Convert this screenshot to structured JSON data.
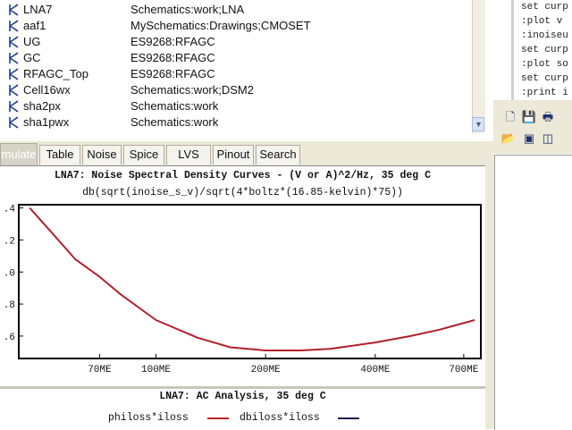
{
  "cell_list": {
    "rows": [
      {
        "name": "LNA7",
        "library": "Schematics:work;LNA"
      },
      {
        "name": "aaf1",
        "library": "MySchematics:Drawings;CMOSET"
      },
      {
        "name": "UG",
        "library": "ES9268:RFAGC"
      },
      {
        "name": "GC",
        "library": "ES9268:RFAGC"
      },
      {
        "name": "RFAGC_Top",
        "library": "ES9268:RFAGC"
      },
      {
        "name": "Cell16wx",
        "library": "Schematics:work;DSM2"
      },
      {
        "name": "sha2px",
        "library": "Schematics:work"
      },
      {
        "name": "sha1pwx",
        "library": "Schematics:work"
      }
    ],
    "icon": "schematic-cell-icon"
  },
  "console": {
    "lines": [
      "set curp",
      ":plot v",
      ":inoiseu",
      "set curp",
      ":plot so",
      "set curp",
      ":print i"
    ]
  },
  "tabs": [
    {
      "label": "mulate",
      "active": true
    },
    {
      "label": "Table",
      "active": false
    },
    {
      "label": "Noise",
      "active": false
    },
    {
      "label": "Spice",
      "active": false
    },
    {
      "label": "LVS",
      "active": false
    },
    {
      "label": "Pinout",
      "active": false
    },
    {
      "label": "Search",
      "active": false
    }
  ],
  "plot": {
    "title": "LNA7: Noise Spectral Density Curves - (V or A)^2/Hz, 35 deg C",
    "subtitle": "db(sqrt(inoise_s_v)/sqrt(4*boltz*(16.85-kelvin)*75))"
  },
  "chart_data": {
    "type": "line",
    "title": "LNA7: Noise Spectral Density Curves - (V or A)^2/Hz, 35 deg C",
    "subtitle": "db(sqrt(inoise_s_v)/sqrt(4*boltz*(16.85-kelvin)*75))",
    "x_scale": "log",
    "x_ticks": [
      {
        "value": 70,
        "label": "70ME"
      },
      {
        "value": 100,
        "label": "100ME"
      },
      {
        "value": 200,
        "label": "200ME"
      },
      {
        "value": 400,
        "label": "400ME"
      },
      {
        "value": 700,
        "label": "700ME"
      }
    ],
    "y_ticks": [
      {
        "value": 3.4,
        "label": ".4"
      },
      {
        "value": 3.2,
        "label": ".2"
      },
      {
        "value": 3.0,
        "label": ".0"
      },
      {
        "value": 2.8,
        "label": ".8"
      },
      {
        "value": 2.6,
        "label": ".6"
      }
    ],
    "xlim": [
      42,
      780
    ],
    "ylim": [
      2.46,
      3.42
    ],
    "color": "#b3202a",
    "series": [
      {
        "x": [
          45,
          52,
          60,
          70,
          80,
          100,
          130,
          160,
          200,
          250,
          300,
          400,
          500,
          600,
          750
        ],
        "y": [
          3.4,
          3.24,
          3.08,
          2.97,
          2.86,
          2.7,
          2.59,
          2.53,
          2.51,
          2.51,
          2.52,
          2.56,
          2.6,
          2.64,
          2.7
        ]
      }
    ]
  },
  "ac_analysis": {
    "title": "LNA7: AC Analysis, 35 deg C",
    "legend": [
      {
        "label": "philoss*iloss",
        "color": "#c0202a"
      },
      {
        "label": "dbiloss*iloss",
        "color": "#1a1a50"
      }
    ]
  },
  "toolbar": {
    "icons": [
      "new-file-icon",
      "save-icon",
      "print-icon",
      "open-folder-icon",
      "save-all-icon",
      "panel-icon"
    ]
  }
}
